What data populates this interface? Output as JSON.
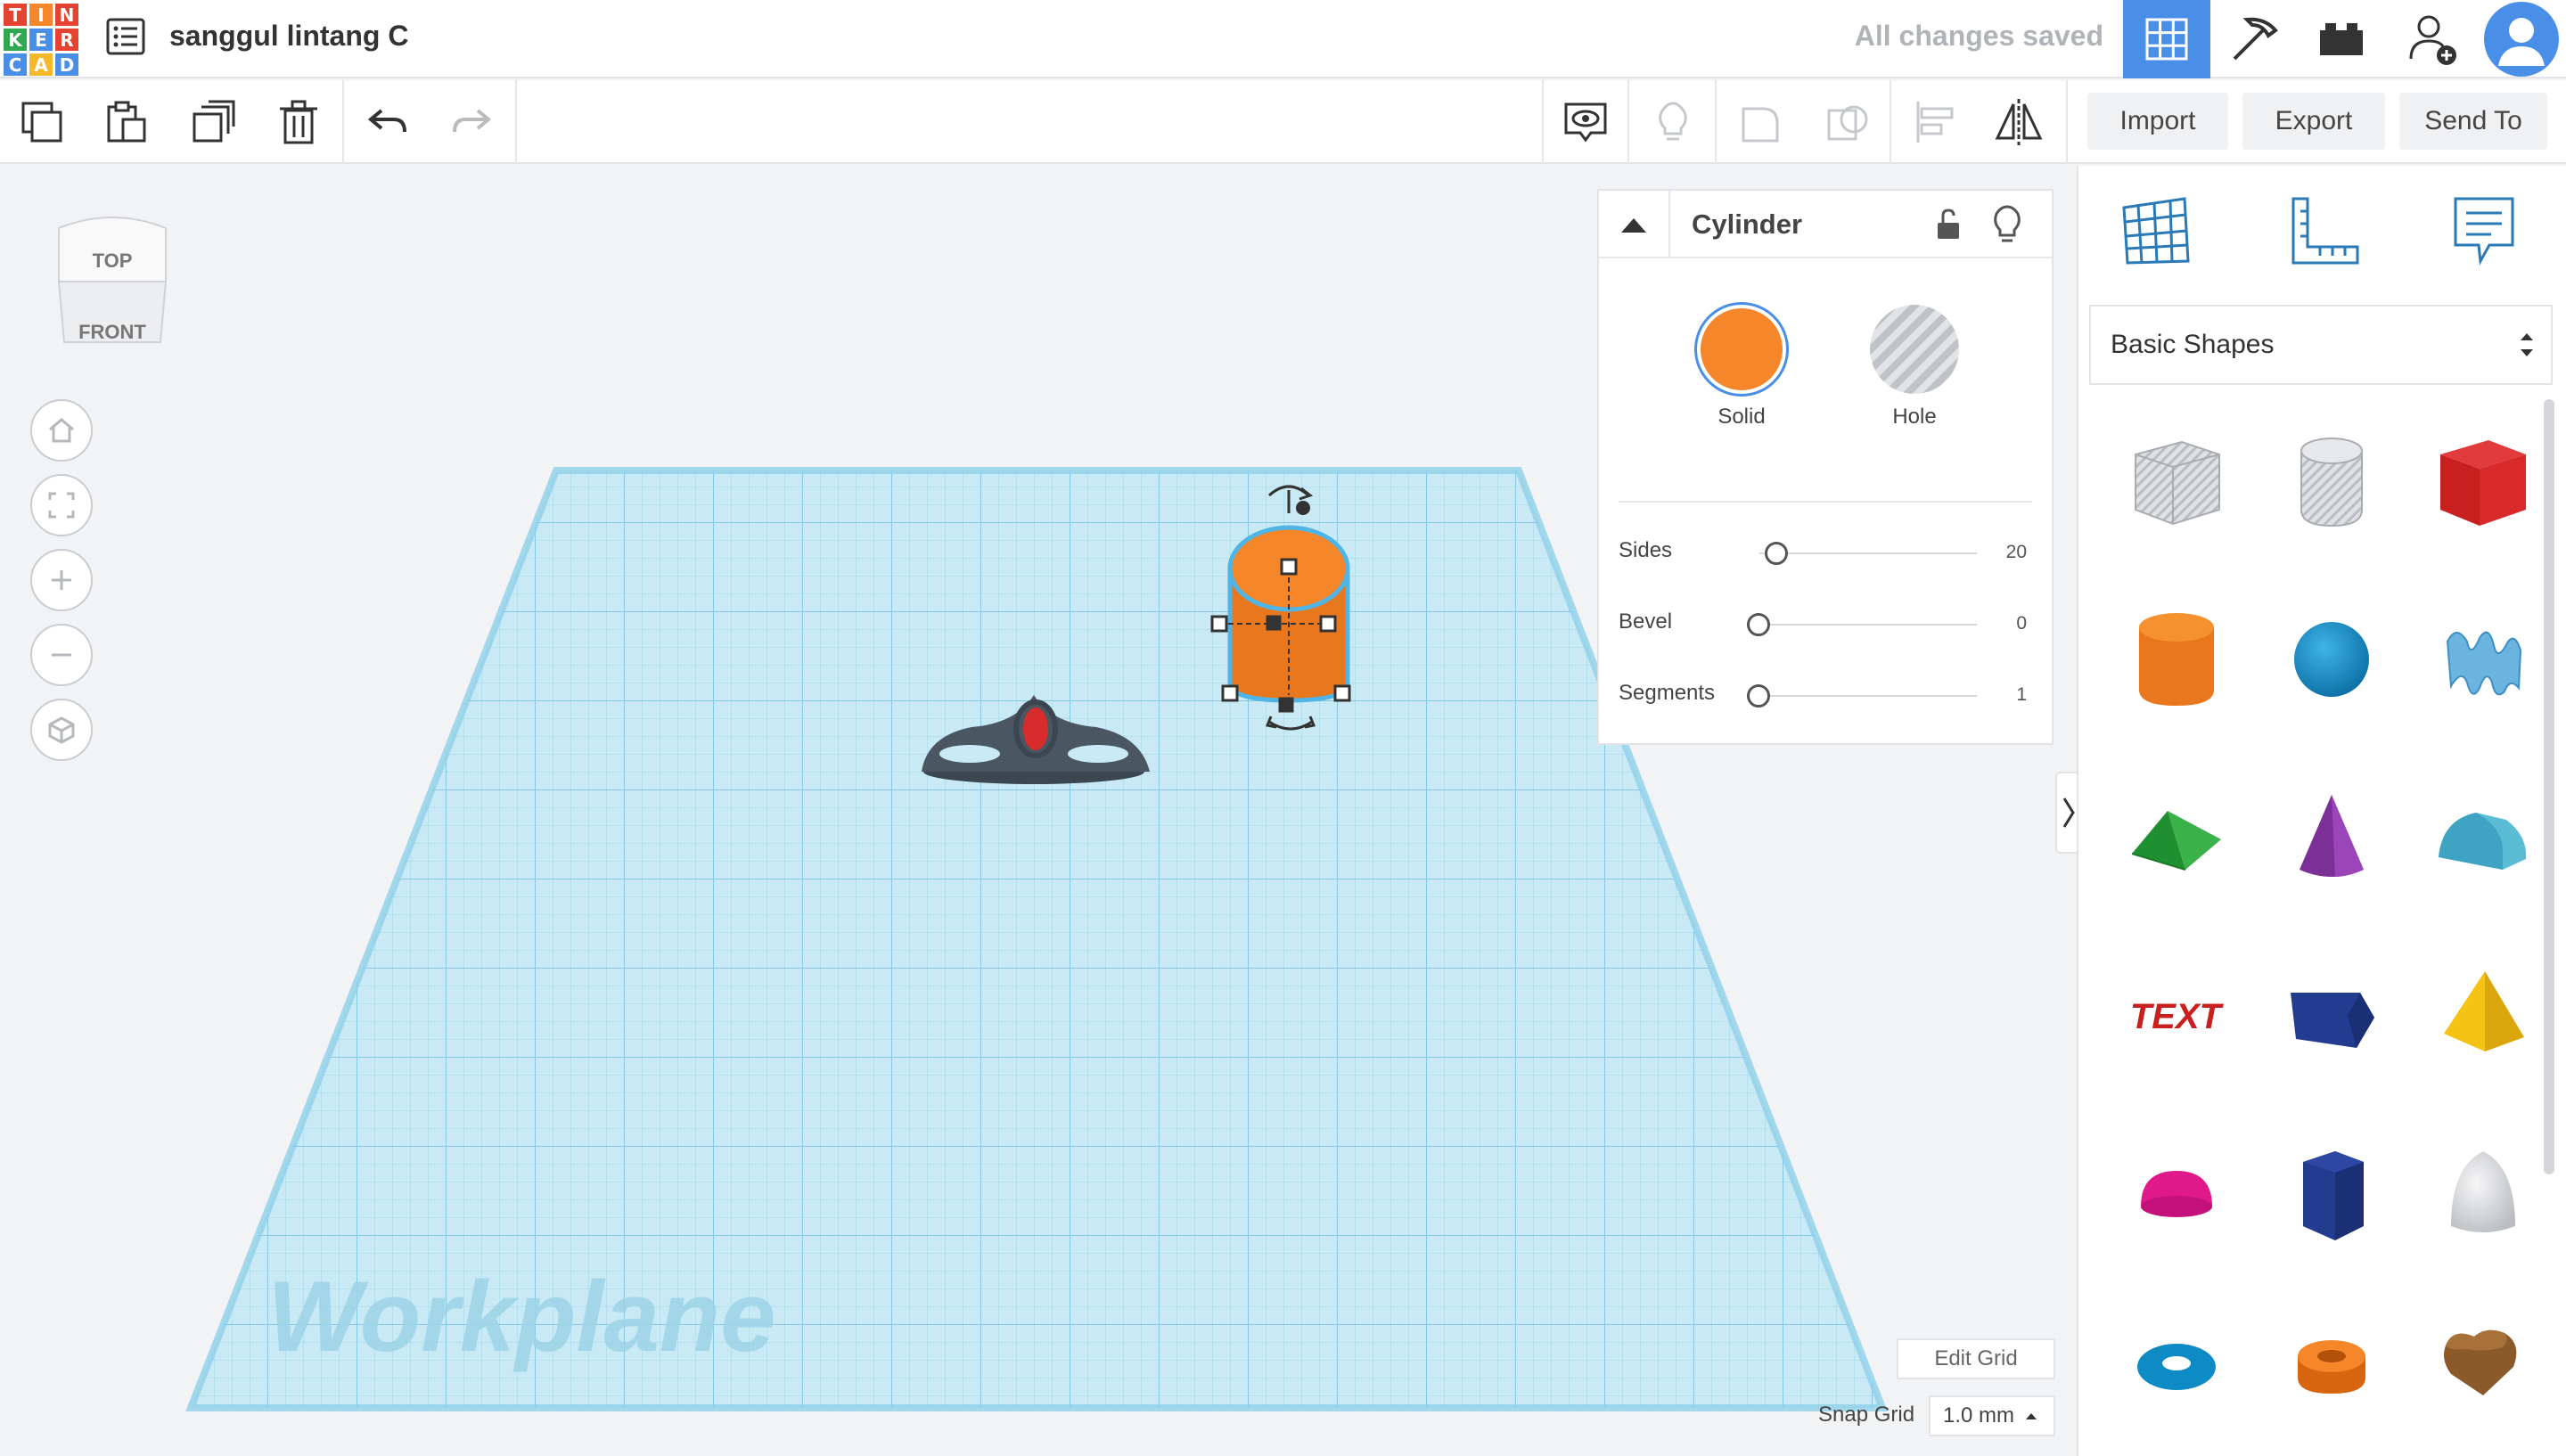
{
  "logo": {
    "letters": [
      "T",
      "I",
      "N",
      "K",
      "E",
      "R",
      "C",
      "A",
      "D"
    ]
  },
  "project": {
    "title": "sanggul lintang C"
  },
  "status": {
    "saved": "All changes saved"
  },
  "toolbar": {
    "import_label": "Import",
    "export_label": "Export",
    "send_to_label": "Send To"
  },
  "viewcube": {
    "top": "TOP",
    "front": "FRONT"
  },
  "inspector": {
    "title": "Cylinder",
    "solid_label": "Solid",
    "hole_label": "Hole",
    "solid_color": "#f5862a",
    "props": [
      {
        "label": "Sides",
        "value": "20",
        "fraction": 0.05
      },
      {
        "label": "Bevel",
        "value": "0",
        "fraction": 0.0
      },
      {
        "label": "Segments",
        "value": "1",
        "fraction": 0.0
      }
    ]
  },
  "workplane": {
    "label": "Workplane"
  },
  "grid": {
    "edit_label": "Edit Grid",
    "snap_label": "Snap Grid",
    "snap_value": "1.0 mm"
  },
  "sidebar": {
    "category": "Basic Shapes",
    "shapes": [
      "box-hole",
      "cylinder-hole",
      "box",
      "cylinder",
      "sphere",
      "scribble",
      "roof",
      "cone",
      "round-roof",
      "text",
      "prism",
      "pyramid",
      "half-sphere",
      "polygon",
      "paraboloid",
      "torus",
      "tube",
      "heart"
    ]
  },
  "text_shape_label": "TEXT",
  "colors": {
    "accent": "#4a8fe7",
    "grid": "#aee0f0",
    "orange": "#f5862a"
  }
}
